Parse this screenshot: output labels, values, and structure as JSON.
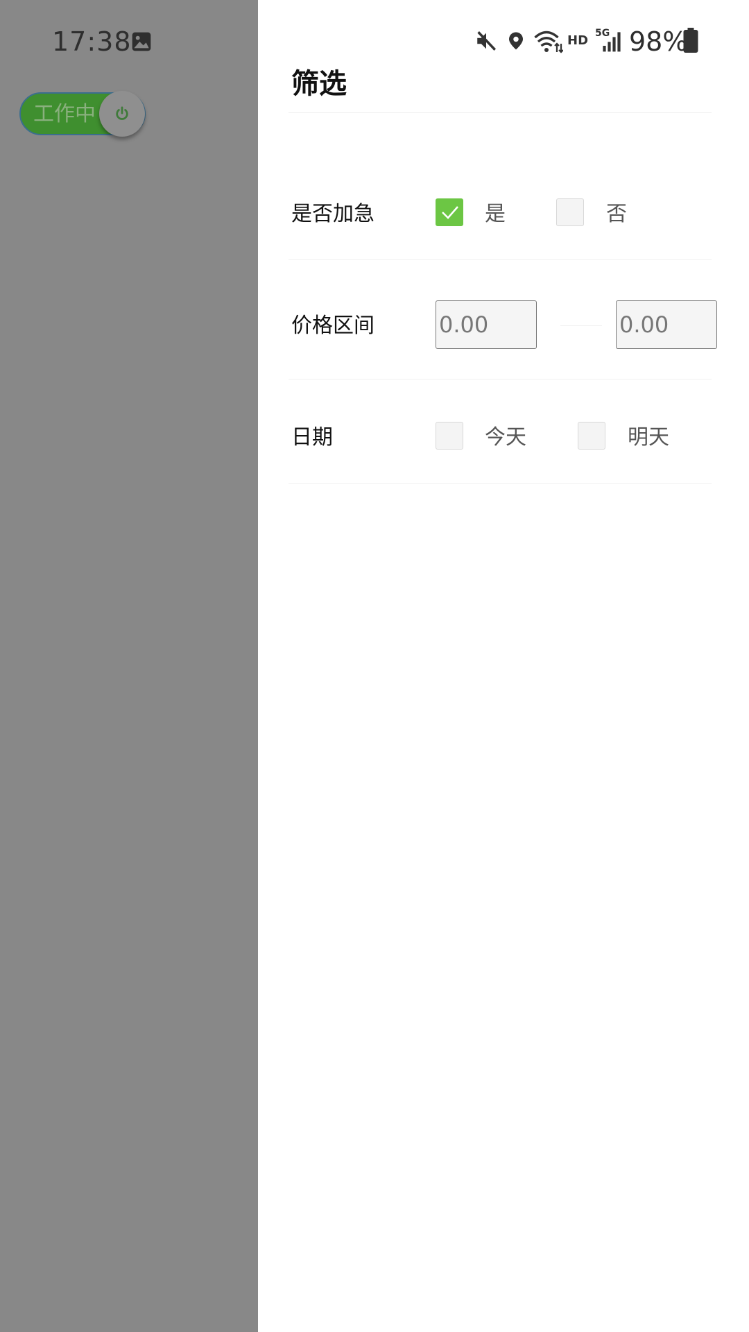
{
  "status_bar": {
    "time": "17:38",
    "battery": "98%",
    "hd": "HD",
    "network": "5G",
    "icons": [
      "image-icon",
      "mute-icon",
      "location-icon",
      "wifi-icon",
      "signal-icon",
      "battery-icon"
    ]
  },
  "work_toggle": {
    "label": "工作中",
    "accent": "#3f8f2f"
  },
  "drawer": {
    "title": "筛选",
    "urgent": {
      "label": "是否加急",
      "options": [
        {
          "label": "是",
          "checked": true
        },
        {
          "label": "否",
          "checked": false
        }
      ]
    },
    "price": {
      "label": "价格区间",
      "min_placeholder": "0.00",
      "max_placeholder": "0.00"
    },
    "date": {
      "label": "日期",
      "options": [
        {
          "label": "今天",
          "checked": false
        },
        {
          "label": "明天",
          "checked": false
        }
      ]
    },
    "check_color": "#6cc644"
  }
}
